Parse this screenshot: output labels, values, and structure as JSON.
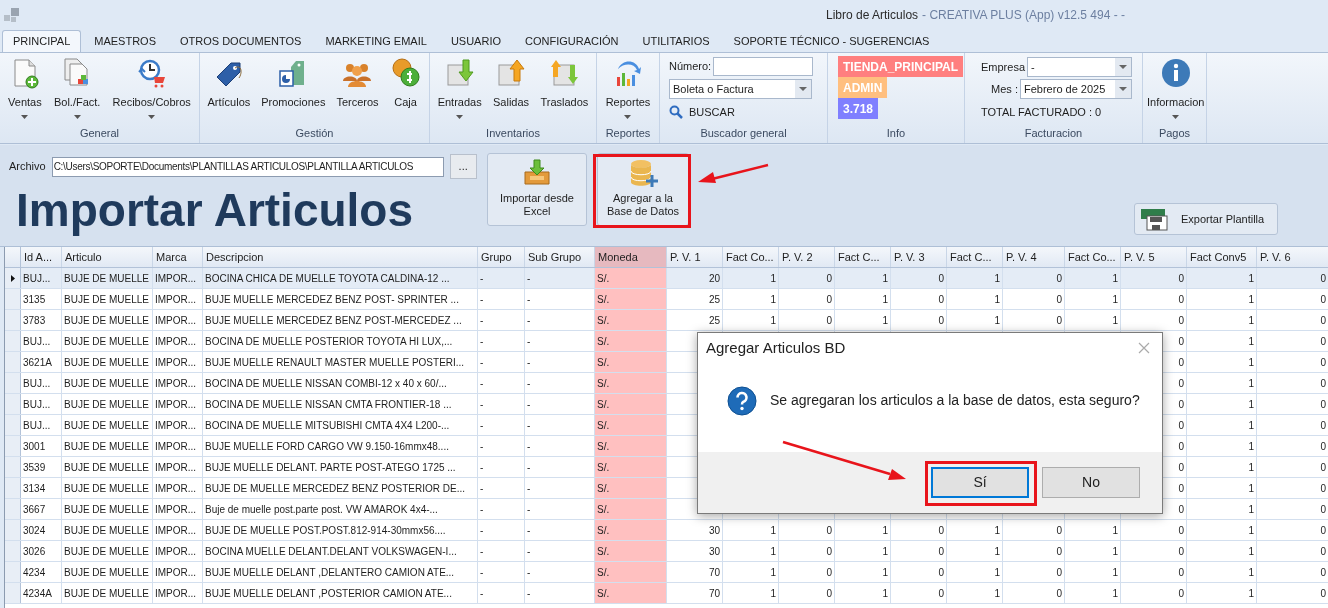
{
  "window": {
    "title": "Libro de Articulos",
    "subtitle": "- CREATIVA PLUS (App) v12.5 494 - -"
  },
  "tabs": [
    {
      "label": "PRINCIPAL",
      "selected": true
    },
    {
      "label": "MAESTROS",
      "selected": false
    },
    {
      "label": "OTROS DOCUMENTOS",
      "selected": false
    },
    {
      "label": "MARKETING EMAIL",
      "selected": false
    },
    {
      "label": "USUARIO",
      "selected": false
    },
    {
      "label": "CONFIGURACIÓN",
      "selected": false
    },
    {
      "label": "UTILITARIOS",
      "selected": false
    },
    {
      "label": "SOPORTE TÉCNICO - SUGERENCIAS",
      "selected": false
    }
  ],
  "ribbon": {
    "groups": [
      {
        "kind": "buttons",
        "label": "General",
        "buttons": [
          {
            "label": "Ventas",
            "dropdown": true
          },
          {
            "label": "Bol./Fact.",
            "dropdown": true
          },
          {
            "label": "Recibos/Cobros",
            "dropdown": true
          }
        ]
      },
      {
        "kind": "buttons",
        "label": "Gestión",
        "buttons": [
          {
            "label": "Artículos",
            "dropdown": false
          },
          {
            "label": "Promociones",
            "dropdown": false
          },
          {
            "label": "Terceros",
            "dropdown": false
          },
          {
            "label": "Caja",
            "dropdown": false
          }
        ]
      },
      {
        "kind": "buttons",
        "label": "Inventarios",
        "buttons": [
          {
            "label": "Entradas",
            "dropdown": true
          },
          {
            "label": "Salidas",
            "dropdown": false
          },
          {
            "label": "Traslados",
            "dropdown": false
          }
        ]
      },
      {
        "kind": "buttons",
        "label": "Reportes",
        "buttons": [
          {
            "label": "Reportes",
            "dropdown": true
          }
        ]
      },
      {
        "kind": "search",
        "label": "Buscador general",
        "number_label": "Número:",
        "document_type": "Boleta o Factura",
        "search_button": "BUSCAR"
      },
      {
        "kind": "info",
        "label": "Info",
        "badges": [
          {
            "text": "TIENDA_PRINCIPAL",
            "color": "#ff7f7f"
          },
          {
            "text": "ADMIN",
            "color": "#ffbf7f"
          },
          {
            "text": "3.718",
            "color": "#7f7fff"
          }
        ]
      },
      {
        "kind": "billing",
        "label": "Facturacion",
        "company_label": "Empresa",
        "company_value": "-",
        "month_label": "Mes :",
        "month_value": "Febrero de 2025",
        "total": "TOTAL FACTURADO : 0"
      },
      {
        "kind": "buttons",
        "label": "Pagos",
        "buttons": [
          {
            "label": "Informacion",
            "dropdown": true
          }
        ]
      }
    ]
  },
  "import_panel": {
    "file_label": "Archivo",
    "file_path": "C:\\Users\\SOPORTE\\Documents\\PLANTILLAS ARTICULOS\\PLANTILLA ARTICULOS",
    "browse_button": "...",
    "heading": "Importar Articulos",
    "buttons": [
      {
        "label": "Importar desde Excel"
      },
      {
        "label": "Agregar a la Base de Datos"
      }
    ],
    "export_button": "Exportar Plantilla"
  },
  "grid": {
    "columns": [
      {
        "label": "Id A...",
        "kind": "text"
      },
      {
        "label": "Articulo",
        "kind": "text"
      },
      {
        "label": "Marca",
        "kind": "text"
      },
      {
        "label": "Descripcion",
        "kind": "text"
      },
      {
        "label": "Grupo",
        "kind": "text"
      },
      {
        "label": "Sub Grupo",
        "kind": "text"
      },
      {
        "label": "Moneda",
        "kind": "currency"
      },
      {
        "label": "P. V. 1",
        "kind": "number"
      },
      {
        "label": "Fact Co...",
        "kind": "number"
      },
      {
        "label": "P. V. 2",
        "kind": "number"
      },
      {
        "label": "Fact C...",
        "kind": "number"
      },
      {
        "label": "P. V. 3",
        "kind": "number"
      },
      {
        "label": "Fact C...",
        "kind": "number"
      },
      {
        "label": "P. V. 4",
        "kind": "number"
      },
      {
        "label": "Fact Co...",
        "kind": "number"
      },
      {
        "label": "P. V. 5",
        "kind": "number"
      },
      {
        "label": "Fact Conv5",
        "kind": "number"
      },
      {
        "label": "P. V. 6",
        "kind": "number"
      }
    ],
    "rows": [
      {
        "selected": true,
        "cells": [
          "BUJ...",
          "BUJE DE MUELLE",
          "IMPOR...",
          "BOCINA CHICA DE MUELLE TOYOTA CALDINA-12 ...",
          "-",
          "-",
          "S/.",
          "20",
          "1",
          "0",
          "1",
          "0",
          "1",
          "0",
          "1",
          "0",
          "1",
          "0"
        ]
      },
      {
        "selected": false,
        "cells": [
          "3135",
          "BUJE DE MUELLE",
          "IMPOR...",
          "BUJE MUELLE MERCEDEZ BENZ POST- SPRINTER ...",
          "-",
          "-",
          "S/.",
          "25",
          "1",
          "0",
          "1",
          "0",
          "1",
          "0",
          "1",
          "0",
          "1",
          "0"
        ]
      },
      {
        "selected": false,
        "cells": [
          "3783",
          "BUJE DE MUELLE",
          "IMPOR...",
          "BUJE MUELLE MERCEDEZ BENZ POST-MERCEDEZ ...",
          "-",
          "-",
          "S/.",
          "25",
          "1",
          "0",
          "1",
          "0",
          "1",
          "0",
          "1",
          "0",
          "1",
          "0"
        ]
      },
      {
        "selected": false,
        "cells": [
          "BUJ...",
          "BUJE DE MUELLE",
          "IMPOR...",
          "BOCINA DE MUELLE POSTERIOR TOYOTA HI LUX,...",
          "-",
          "-",
          "S/.",
          null,
          null,
          null,
          null,
          null,
          null,
          null,
          null,
          "0",
          "1",
          "0"
        ]
      },
      {
        "selected": false,
        "cells": [
          "3621A",
          "BUJE DE MUELLE",
          "IMPOR...",
          "BUJE MUELLE RENAULT MASTER MUELLE POSTERI...",
          "-",
          "-",
          "S/.",
          null,
          null,
          null,
          null,
          null,
          null,
          null,
          null,
          "0",
          "1",
          "0"
        ]
      },
      {
        "selected": false,
        "cells": [
          "BUJ...",
          "BUJE DE MUELLE",
          "IMPOR...",
          "BOCINA DE MUELLE NISSAN COMBI-12 x 40 x 60/...",
          "-",
          "-",
          "S/.",
          null,
          null,
          null,
          null,
          null,
          null,
          null,
          null,
          "0",
          "1",
          "0"
        ]
      },
      {
        "selected": false,
        "cells": [
          "BUJ...",
          "BUJE DE MUELLE",
          "IMPOR...",
          "BOCINA DE MUELLE NISSAN CMTA FRONTIER-18 ...",
          "-",
          "-",
          "S/.",
          null,
          null,
          null,
          null,
          null,
          null,
          null,
          null,
          "0",
          "1",
          "0"
        ]
      },
      {
        "selected": false,
        "cells": [
          "BUJ...",
          "BUJE DE MUELLE",
          "IMPOR...",
          "BOCINA DE MUELLE MITSUBISHI CMTA 4X4 L200-...",
          "-",
          "-",
          "S/.",
          null,
          null,
          null,
          null,
          null,
          null,
          null,
          null,
          "0",
          "1",
          "0"
        ]
      },
      {
        "selected": false,
        "cells": [
          "3001",
          "BUJE DE MUELLE",
          "IMPOR...",
          "BUJE MUELLE FORD CARGO VW 9.150-16mmx48....",
          "-",
          "-",
          "S/.",
          null,
          null,
          null,
          null,
          null,
          null,
          null,
          null,
          "0",
          "1",
          "0"
        ]
      },
      {
        "selected": false,
        "cells": [
          "3539",
          "BUJE DE MUELLE",
          "IMPOR...",
          "BUJE MUELLE DELANT. PARTE POST-ATEGO 1725 ...",
          "-",
          "-",
          "S/.",
          null,
          null,
          null,
          null,
          null,
          null,
          null,
          null,
          "0",
          "1",
          "0"
        ]
      },
      {
        "selected": false,
        "cells": [
          "3134",
          "BUJE DE MUELLE",
          "IMPOR...",
          "BUJE DE MUELLE MERCEDEZ BENZ POSTERIOR DE...",
          "-",
          "-",
          "S/.",
          null,
          null,
          null,
          null,
          null,
          null,
          null,
          null,
          "0",
          "1",
          "0"
        ]
      },
      {
        "selected": false,
        "cells": [
          "3667",
          "BUJE DE MUELLE",
          "IMPOR...",
          "Buje de muelle post.parte post. VW AMAROK 4x4-...",
          "-",
          "-",
          "S/.",
          null,
          null,
          null,
          null,
          null,
          null,
          null,
          null,
          "0",
          "1",
          "0"
        ]
      },
      {
        "selected": false,
        "cells": [
          "3024",
          "BUJE DE MUELLE",
          "IMPOR...",
          "BUJE DE MUELLE POST.POST.812-914-30mmx56....",
          "-",
          "-",
          "S/.",
          "30",
          "1",
          "0",
          "1",
          "0",
          "1",
          "0",
          "1",
          "0",
          "1",
          "0"
        ]
      },
      {
        "selected": false,
        "cells": [
          "3026",
          "BUJE DE MUELLE",
          "IMPOR...",
          "BOCINA MUELLE DELANT.DELANT VOLKSWAGEN-I...",
          "-",
          "-",
          "S/.",
          "30",
          "1",
          "0",
          "1",
          "0",
          "1",
          "0",
          "1",
          "0",
          "1",
          "0"
        ]
      },
      {
        "selected": false,
        "cells": [
          "4234",
          "BUJE DE MUELLE",
          "IMPOR...",
          "BUJE MUELLE DELANT ,DELANTERO CAMION ATE...",
          "-",
          "-",
          "S/.",
          "70",
          "1",
          "0",
          "1",
          "0",
          "1",
          "0",
          "1",
          "0",
          "1",
          "0"
        ]
      },
      {
        "selected": false,
        "cells": [
          "4234A",
          "BUJE DE MUELLE",
          "IMPOR...",
          "BUJE MUELLE DELANT ,POSTERIOR CAMION ATE...",
          "-",
          "-",
          "S/.",
          "70",
          "1",
          "0",
          "1",
          "0",
          "1",
          "0",
          "1",
          "0",
          "1",
          "0"
        ]
      }
    ]
  },
  "dialog": {
    "title": "Agregar Articulos BD",
    "message": "Se agregaran los articulos a la base de datos, esta seguro?",
    "buttons": [
      {
        "label": "Sí",
        "default": true
      },
      {
        "label": "No",
        "default": false
      }
    ]
  }
}
